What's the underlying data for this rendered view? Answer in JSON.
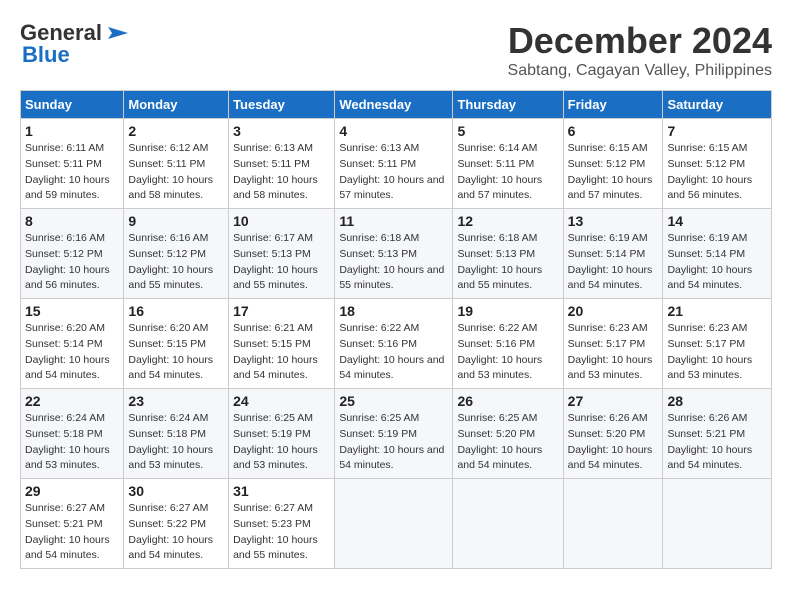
{
  "header": {
    "logo_general": "General",
    "logo_blue": "Blue",
    "month_title": "December 2024",
    "location": "Sabtang, Cagayan Valley, Philippines"
  },
  "weekdays": [
    "Sunday",
    "Monday",
    "Tuesday",
    "Wednesday",
    "Thursday",
    "Friday",
    "Saturday"
  ],
  "weeks": [
    [
      {
        "day": "1",
        "sunrise": "Sunrise: 6:11 AM",
        "sunset": "Sunset: 5:11 PM",
        "daylight": "Daylight: 10 hours and 59 minutes."
      },
      {
        "day": "2",
        "sunrise": "Sunrise: 6:12 AM",
        "sunset": "Sunset: 5:11 PM",
        "daylight": "Daylight: 10 hours and 58 minutes."
      },
      {
        "day": "3",
        "sunrise": "Sunrise: 6:13 AM",
        "sunset": "Sunset: 5:11 PM",
        "daylight": "Daylight: 10 hours and 58 minutes."
      },
      {
        "day": "4",
        "sunrise": "Sunrise: 6:13 AM",
        "sunset": "Sunset: 5:11 PM",
        "daylight": "Daylight: 10 hours and 57 minutes."
      },
      {
        "day": "5",
        "sunrise": "Sunrise: 6:14 AM",
        "sunset": "Sunset: 5:11 PM",
        "daylight": "Daylight: 10 hours and 57 minutes."
      },
      {
        "day": "6",
        "sunrise": "Sunrise: 6:15 AM",
        "sunset": "Sunset: 5:12 PM",
        "daylight": "Daylight: 10 hours and 57 minutes."
      },
      {
        "day": "7",
        "sunrise": "Sunrise: 6:15 AM",
        "sunset": "Sunset: 5:12 PM",
        "daylight": "Daylight: 10 hours and 56 minutes."
      }
    ],
    [
      {
        "day": "8",
        "sunrise": "Sunrise: 6:16 AM",
        "sunset": "Sunset: 5:12 PM",
        "daylight": "Daylight: 10 hours and 56 minutes."
      },
      {
        "day": "9",
        "sunrise": "Sunrise: 6:16 AM",
        "sunset": "Sunset: 5:12 PM",
        "daylight": "Daylight: 10 hours and 55 minutes."
      },
      {
        "day": "10",
        "sunrise": "Sunrise: 6:17 AM",
        "sunset": "Sunset: 5:13 PM",
        "daylight": "Daylight: 10 hours and 55 minutes."
      },
      {
        "day": "11",
        "sunrise": "Sunrise: 6:18 AM",
        "sunset": "Sunset: 5:13 PM",
        "daylight": "Daylight: 10 hours and 55 minutes."
      },
      {
        "day": "12",
        "sunrise": "Sunrise: 6:18 AM",
        "sunset": "Sunset: 5:13 PM",
        "daylight": "Daylight: 10 hours and 55 minutes."
      },
      {
        "day": "13",
        "sunrise": "Sunrise: 6:19 AM",
        "sunset": "Sunset: 5:14 PM",
        "daylight": "Daylight: 10 hours and 54 minutes."
      },
      {
        "day": "14",
        "sunrise": "Sunrise: 6:19 AM",
        "sunset": "Sunset: 5:14 PM",
        "daylight": "Daylight: 10 hours and 54 minutes."
      }
    ],
    [
      {
        "day": "15",
        "sunrise": "Sunrise: 6:20 AM",
        "sunset": "Sunset: 5:14 PM",
        "daylight": "Daylight: 10 hours and 54 minutes."
      },
      {
        "day": "16",
        "sunrise": "Sunrise: 6:20 AM",
        "sunset": "Sunset: 5:15 PM",
        "daylight": "Daylight: 10 hours and 54 minutes."
      },
      {
        "day": "17",
        "sunrise": "Sunrise: 6:21 AM",
        "sunset": "Sunset: 5:15 PM",
        "daylight": "Daylight: 10 hours and 54 minutes."
      },
      {
        "day": "18",
        "sunrise": "Sunrise: 6:22 AM",
        "sunset": "Sunset: 5:16 PM",
        "daylight": "Daylight: 10 hours and 54 minutes."
      },
      {
        "day": "19",
        "sunrise": "Sunrise: 6:22 AM",
        "sunset": "Sunset: 5:16 PM",
        "daylight": "Daylight: 10 hours and 53 minutes."
      },
      {
        "day": "20",
        "sunrise": "Sunrise: 6:23 AM",
        "sunset": "Sunset: 5:17 PM",
        "daylight": "Daylight: 10 hours and 53 minutes."
      },
      {
        "day": "21",
        "sunrise": "Sunrise: 6:23 AM",
        "sunset": "Sunset: 5:17 PM",
        "daylight": "Daylight: 10 hours and 53 minutes."
      }
    ],
    [
      {
        "day": "22",
        "sunrise": "Sunrise: 6:24 AM",
        "sunset": "Sunset: 5:18 PM",
        "daylight": "Daylight: 10 hours and 53 minutes."
      },
      {
        "day": "23",
        "sunrise": "Sunrise: 6:24 AM",
        "sunset": "Sunset: 5:18 PM",
        "daylight": "Daylight: 10 hours and 53 minutes."
      },
      {
        "day": "24",
        "sunrise": "Sunrise: 6:25 AM",
        "sunset": "Sunset: 5:19 PM",
        "daylight": "Daylight: 10 hours and 53 minutes."
      },
      {
        "day": "25",
        "sunrise": "Sunrise: 6:25 AM",
        "sunset": "Sunset: 5:19 PM",
        "daylight": "Daylight: 10 hours and 54 minutes."
      },
      {
        "day": "26",
        "sunrise": "Sunrise: 6:25 AM",
        "sunset": "Sunset: 5:20 PM",
        "daylight": "Daylight: 10 hours and 54 minutes."
      },
      {
        "day": "27",
        "sunrise": "Sunrise: 6:26 AM",
        "sunset": "Sunset: 5:20 PM",
        "daylight": "Daylight: 10 hours and 54 minutes."
      },
      {
        "day": "28",
        "sunrise": "Sunrise: 6:26 AM",
        "sunset": "Sunset: 5:21 PM",
        "daylight": "Daylight: 10 hours and 54 minutes."
      }
    ],
    [
      {
        "day": "29",
        "sunrise": "Sunrise: 6:27 AM",
        "sunset": "Sunset: 5:21 PM",
        "daylight": "Daylight: 10 hours and 54 minutes."
      },
      {
        "day": "30",
        "sunrise": "Sunrise: 6:27 AM",
        "sunset": "Sunset: 5:22 PM",
        "daylight": "Daylight: 10 hours and 54 minutes."
      },
      {
        "day": "31",
        "sunrise": "Sunrise: 6:27 AM",
        "sunset": "Sunset: 5:23 PM",
        "daylight": "Daylight: 10 hours and 55 minutes."
      },
      null,
      null,
      null,
      null
    ]
  ]
}
